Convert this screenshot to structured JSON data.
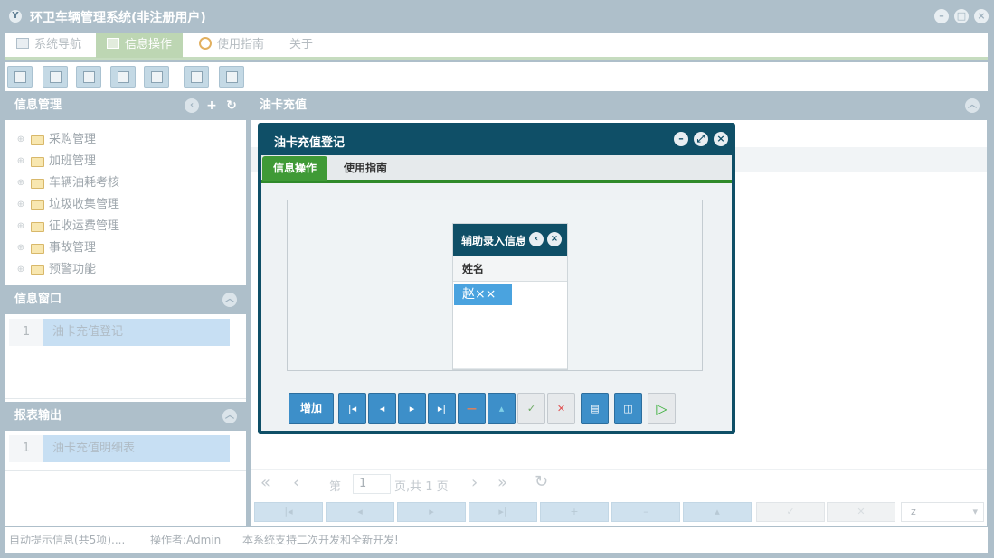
{
  "app": {
    "title": "环卫车辆管理系统(非注册用户)",
    "logo": "Y"
  },
  "menu": {
    "items": [
      {
        "label": "系统导航",
        "icon": "window-icon"
      },
      {
        "label": "信息操作",
        "icon": "grid-icon",
        "active": true
      },
      {
        "label": "使用指南",
        "icon": "clock-icon"
      },
      {
        "label": "关于"
      }
    ]
  },
  "left": {
    "info_mgmt": {
      "title": "信息管理",
      "tree": [
        "采购管理",
        "加班管理",
        "车辆油耗考核",
        "垃圾收集管理",
        "征收运费管理",
        "事故管理",
        "预警功能"
      ]
    },
    "info_window": {
      "title": "信息窗口",
      "rows": [
        {
          "num": "1",
          "label": "油卡充值登记"
        }
      ]
    },
    "report": {
      "title": "报表输出",
      "rows": [
        {
          "num": "1",
          "label": "油卡充值明细表"
        }
      ]
    }
  },
  "main": {
    "title": "油卡充值",
    "pager": {
      "prefix": "第",
      "page": "1",
      "suffix": "页,共 1 页"
    },
    "bottom_select": "z"
  },
  "dialog": {
    "title": "油卡充值登记",
    "tabs": [
      {
        "label": "信息操作",
        "active": true
      },
      {
        "label": "使用指南"
      }
    ],
    "add_label": "增加"
  },
  "popup": {
    "title": "辅助录入信息",
    "column": "姓名",
    "rows": [
      "赵××"
    ]
  },
  "status": {
    "hint": "自动提示信息(共5项)....",
    "operator": "操作者:Admin",
    "note": "本系统支持二次开发和全新开发!"
  },
  "colors": {
    "accent": "#0f4f67",
    "tab_green": "#3f9a36",
    "header_gray": "#aebfca",
    "button_blue": "#3d8fc9"
  }
}
